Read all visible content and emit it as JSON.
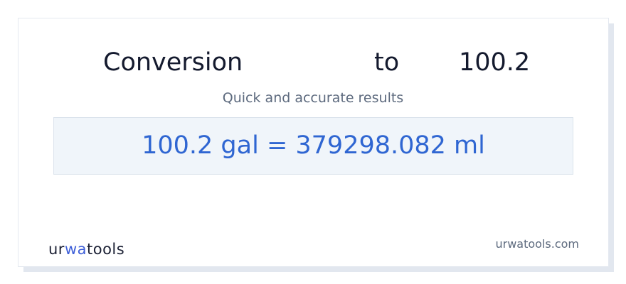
{
  "header": {
    "title_left": "Conversion",
    "title_mid": "to",
    "title_right": "100.2",
    "subtitle": "Quick and accurate results"
  },
  "result": {
    "text": "100.2 gal = 379298.082 ml"
  },
  "footer": {
    "logo": {
      "part1": "ur",
      "accent": "wa",
      "part2": "tools"
    },
    "site": "urwatools.com"
  },
  "colors": {
    "accent": "#2f66d2",
    "title": "#141a2e",
    "muted": "#5d6a7e",
    "result_bg": "#f0f5fa"
  }
}
